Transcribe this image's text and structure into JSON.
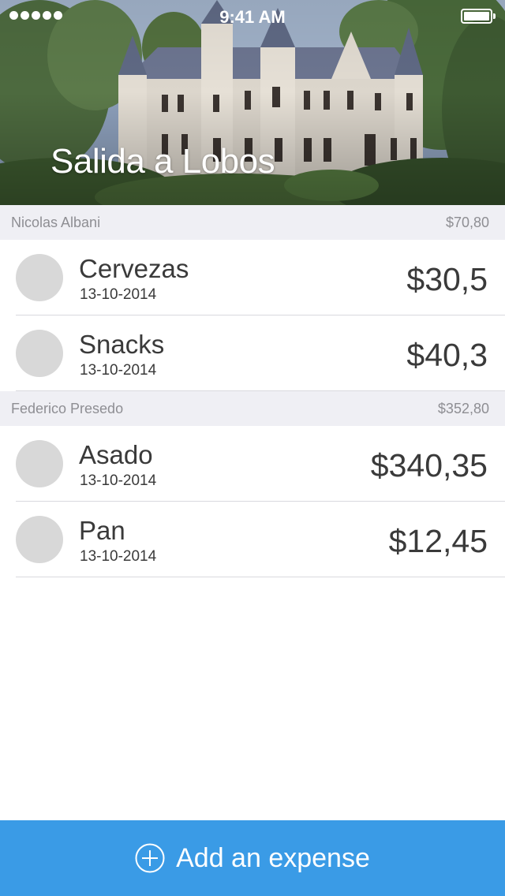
{
  "status_bar": {
    "time": "9:41 AM",
    "signal_icon": "signal-dots-icon",
    "battery_icon": "battery-full-icon"
  },
  "header": {
    "title": "Salida a Lobos",
    "background": "castle-photo"
  },
  "sections": [
    {
      "person": "Nicolas Albani",
      "total": "$70,80",
      "expenses": [
        {
          "name": "Cervezas",
          "date": "13-10-2014",
          "amount": "$30,5"
        },
        {
          "name": "Snacks",
          "date": "13-10-2014",
          "amount": "$40,3"
        }
      ]
    },
    {
      "person": "Federico Presedo",
      "total": "$352,80",
      "expenses": [
        {
          "name": "Asado",
          "date": "13-10-2014",
          "amount": "$340,35"
        },
        {
          "name": "Pan",
          "date": "13-10-2014",
          "amount": "$12,45"
        }
      ]
    }
  ],
  "add_button": {
    "label": "Add an expense",
    "icon": "plus-circle-icon"
  },
  "colors": {
    "accent": "#3a9be6",
    "section_header_bg": "#efeff4",
    "section_header_text": "#8e8e93",
    "text": "#3a3a3a",
    "avatar_placeholder": "#d8d8d8"
  }
}
